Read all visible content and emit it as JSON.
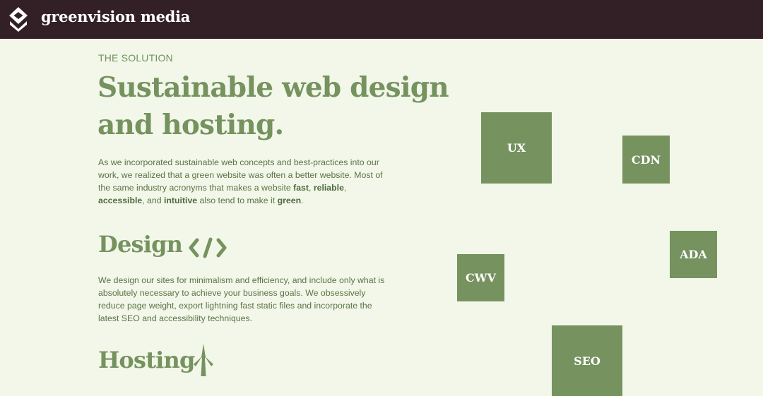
{
  "header": {
    "brand": "greenvision media",
    "logo_icon": "chevron-shield-logo"
  },
  "hero": {
    "eyebrow": "THE SOLUTION",
    "title_line1": "Sustainable web design",
    "title_line2": "and hosting.",
    "intro": {
      "t1": "As we incorporated sustainable web concepts and best-practices into our work, we realized that a green website was often a better website. Most of the same industry acronyms that makes a website ",
      "b1": "fast",
      "t2": ", ",
      "b2": "reliable",
      "t3": ", ",
      "b3": "accessible",
      "t4": ", and ",
      "b4": "intuitive",
      "t5": " also tend to make it ",
      "b5": "green",
      "t6": "."
    }
  },
  "design": {
    "title": "Design",
    "icon": "code-icon",
    "text": "We design our sites for minimalism and efficiency, and include only what is absolutely necessary to achieve your business goals. We obsessively reduce page weight, export lightning fast static files and incorporate the latest SEO and accessibility techniques."
  },
  "hosting": {
    "title": "Hosting",
    "icon": "wind-turbine-icon"
  },
  "tiles": {
    "ux": "UX",
    "cdn": "CDN",
    "ada": "ADA",
    "cwv": "CWV",
    "seo": "SEO"
  },
  "colors": {
    "header_bg": "#332026",
    "page_bg": "#f2f7e9",
    "accent": "#75925f",
    "body_text": "#5b7346"
  }
}
